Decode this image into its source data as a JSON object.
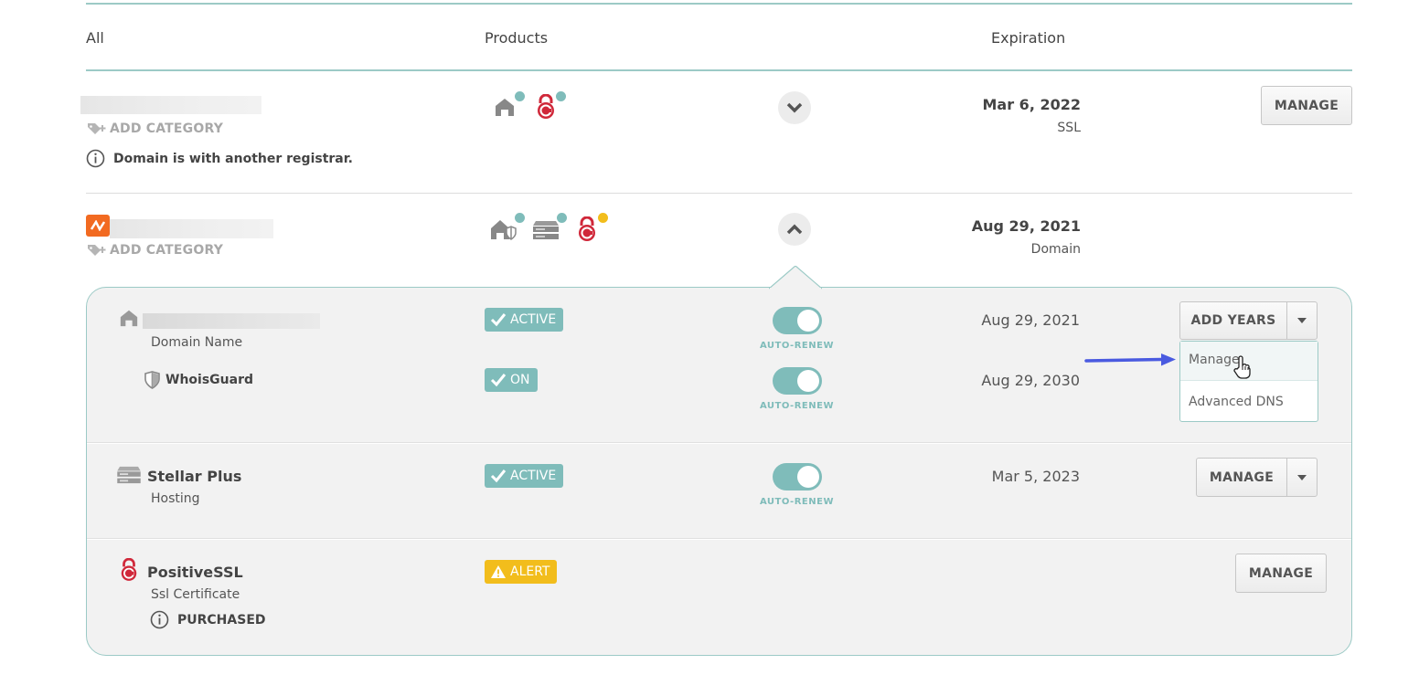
{
  "header": {
    "col_all": "All",
    "col_products": "Products",
    "col_expiration": "Expiration"
  },
  "row1": {
    "add_category": "ADD CATEGORY",
    "notice": "Domain is with another registrar.",
    "expiration_date": "Mar 6, 2022",
    "expiration_type": "SSL",
    "manage_label": "MANAGE"
  },
  "row2": {
    "add_category": "ADD CATEGORY",
    "expiration_date": "Aug 29, 2021",
    "expiration_type": "Domain"
  },
  "details": {
    "domain": {
      "type": "Domain Name",
      "status": "ACTIVE",
      "auto_renew": "AUTO-RENEW",
      "date": "Aug 29, 2021",
      "action_label": "ADD YEARS"
    },
    "whoisguard": {
      "name": "WhoisGuard",
      "status": "ON",
      "auto_renew": "AUTO-RENEW",
      "date": "Aug 29, 2030"
    },
    "hosting": {
      "name": "Stellar Plus",
      "type": "Hosting",
      "status": "ACTIVE",
      "auto_renew": "AUTO-RENEW",
      "date": "Mar 5, 2023",
      "action_label": "MANAGE"
    },
    "ssl": {
      "name": "PositiveSSL",
      "type": "Ssl Certificate",
      "status": "ALERT",
      "purchased": "PURCHASED",
      "action_label": "MANAGE"
    }
  },
  "dropdown": {
    "items": [
      "Manage",
      "Advanced DNS"
    ]
  },
  "colors": {
    "accent": "#7fbcba",
    "alert": "#f2bd1c",
    "ssl_red": "#d0283a",
    "arrow": "#4a5ae0",
    "brand_orange": "#f26a21"
  },
  "icons": [
    "house-icon",
    "ssl-lock-icon",
    "shield-icon",
    "server-icon",
    "tag-plus-icon",
    "info-icon",
    "chevron-down-icon",
    "chevron-up-icon",
    "check-icon",
    "warning-icon",
    "caret-down-icon",
    "hand-cursor-icon",
    "arrow-right-icon",
    "namecheap-logo-icon"
  ]
}
